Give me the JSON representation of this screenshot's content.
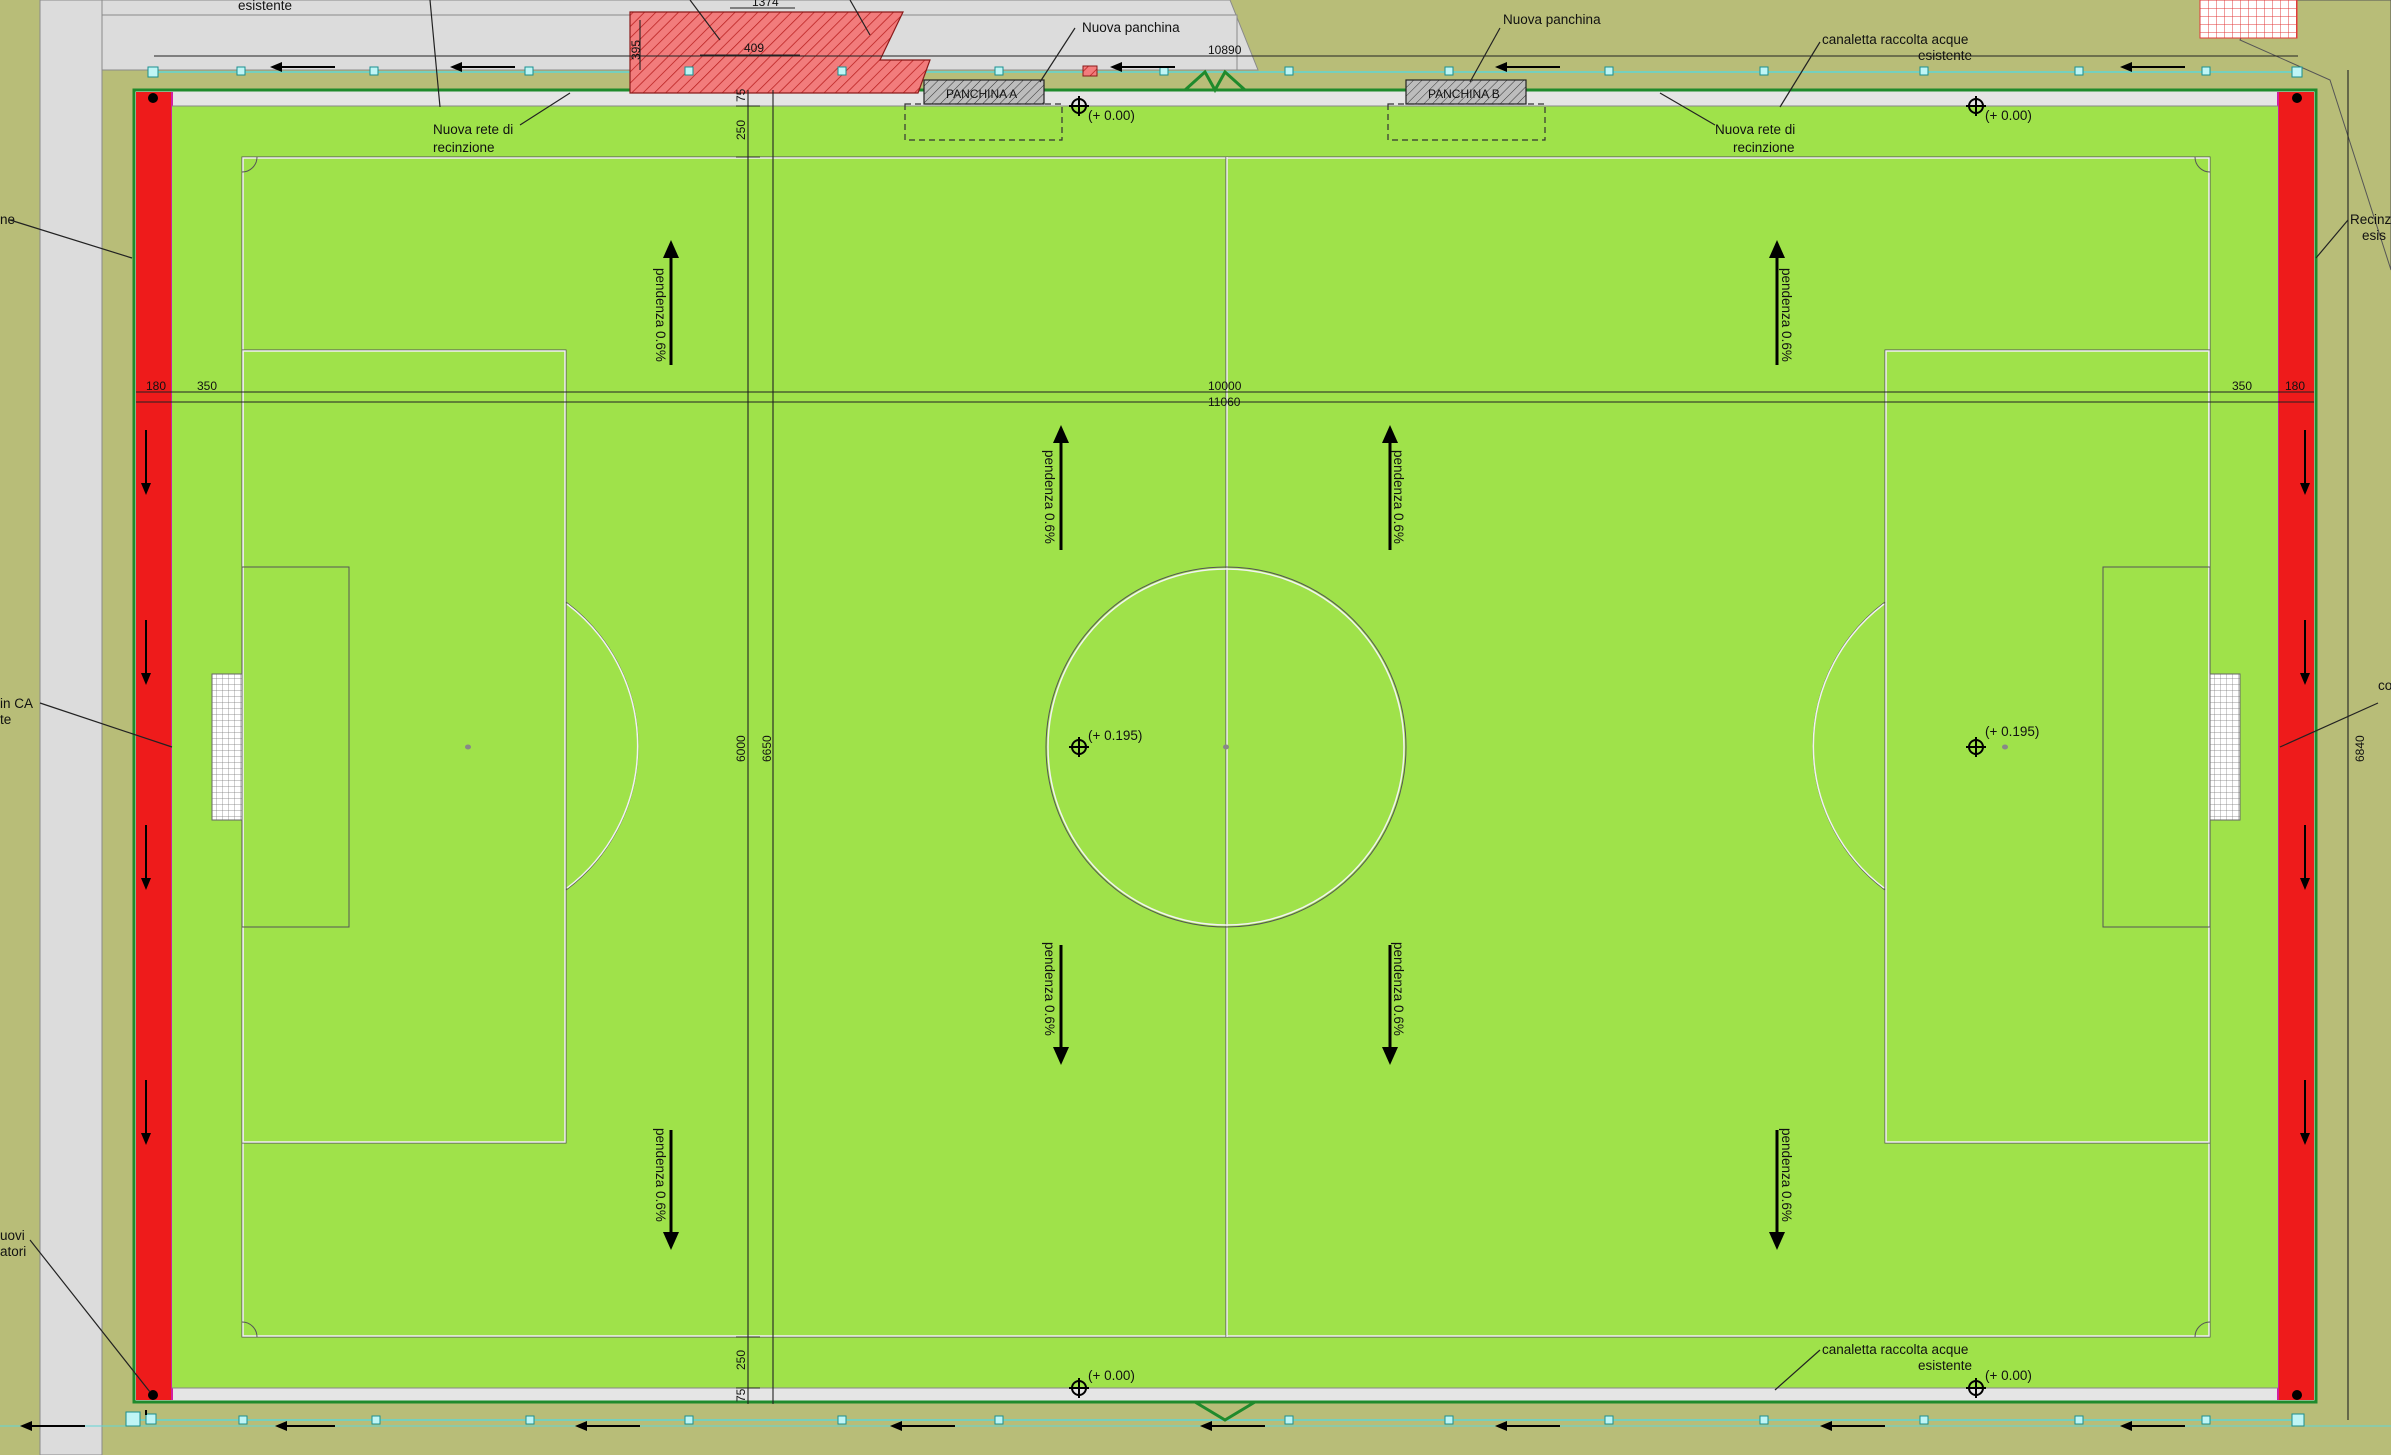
{
  "colors": {
    "surround": "#b8bd78",
    "pitch": "#9fe24a",
    "track_red": "#ee1b1b",
    "path_grey": "#dcdcdc",
    "hatched_zone": "#f27c7c",
    "drain_cyan": "#5fd6d6",
    "fence_green": "#1f8a2c"
  },
  "labels": {
    "top_left_esistente": "esistente",
    "top_dim_1374": "1374",
    "top_dim_409": "409",
    "top_dim_395": "395",
    "top_dim_10890": "10890",
    "nuova_panchina_1": "Nuova panchina",
    "nuova_panchina_2": "Nuova panchina",
    "canaletta_top_1": "canaletta raccolta acque",
    "canaletta_top_2": "esistente",
    "panchina_a": "PANCHINA A",
    "panchina_b": "PANCHINA B",
    "rete_left_1": "Nuova rete di",
    "rete_left_2": "recinzione",
    "rete_right_1": "Nuova rete di",
    "rete_right_2": "recinzione",
    "left_side_1": "ne",
    "left_side_2": "in CA",
    "left_side_3": "te",
    "left_side_4": "uovi",
    "left_side_5": "atori",
    "right_side_1": "Recinz",
    "right_side_2": "esis",
    "right_side_3": "co",
    "dim_75_top": "75",
    "dim_250_top": "250",
    "dim_180_left": "180",
    "dim_350_left": "350",
    "dim_10000": "10000",
    "dim_11060": "11060",
    "dim_350_right": "350",
    "dim_180_right": "180",
    "dim_6000": "6000",
    "dim_6650": "6650",
    "dim_6840": "6840",
    "dim_250_bottom": "250",
    "dim_75_bottom": "75",
    "elev_top_left": "(+ 0.00)",
    "elev_top_right": "(+ 0.00)",
    "elev_center": "(+ 0.195)",
    "elev_right": "(+ 0.195)",
    "elev_bottom_left": "(+ 0.00)",
    "elev_bottom_right": "(+ 0.00)",
    "canaletta_bottom_1": "canaletta raccolta acque",
    "canaletta_bottom_2": "esistente",
    "slope": "pendenza 0.6%"
  }
}
